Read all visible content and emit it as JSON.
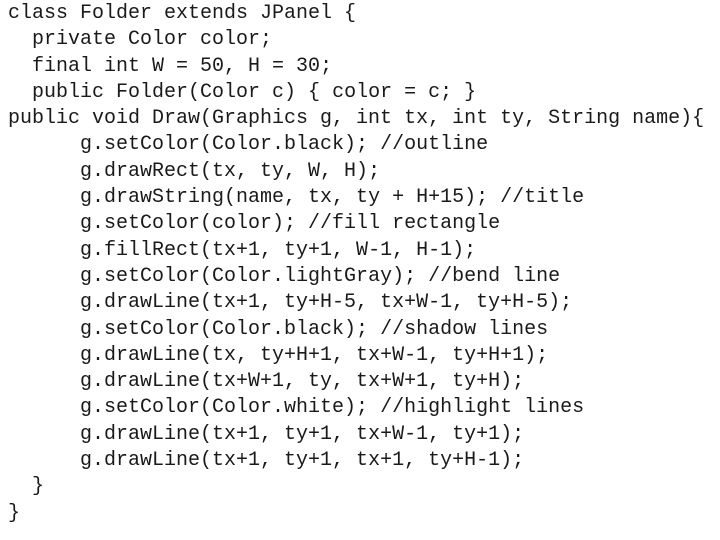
{
  "document": {
    "type": "java-source-code",
    "lines": [
      {
        "indent": 0,
        "text": "class Folder extends JPanel {"
      },
      {
        "indent": 2,
        "text": "private Color color;"
      },
      {
        "indent": 2,
        "text": "final int W = 50, H = 30;"
      },
      {
        "indent": 2,
        "text": "public Folder(Color c) { color = c; }"
      },
      {
        "indent": 0,
        "text": "public void Draw(Graphics g, int tx, int ty, String name){"
      },
      {
        "indent": 6,
        "text": "g.setColor(Color.black); //outline"
      },
      {
        "indent": 6,
        "text": "g.drawRect(tx, ty, W, H);"
      },
      {
        "indent": 6,
        "text": "g.drawString(name, tx, ty + H+15); //title"
      },
      {
        "indent": 6,
        "text": "g.setColor(color); //fill rectangle"
      },
      {
        "indent": 6,
        "text": "g.fillRect(tx+1, ty+1, W-1, H-1);"
      },
      {
        "indent": 6,
        "text": "g.setColor(Color.lightGray); //bend line"
      },
      {
        "indent": 6,
        "text": "g.drawLine(tx+1, ty+H-5, tx+W-1, ty+H-5);"
      },
      {
        "indent": 6,
        "text": "g.setColor(Color.black); //shadow lines"
      },
      {
        "indent": 6,
        "text": "g.drawLine(tx, ty+H+1, tx+W-1, ty+H+1);"
      },
      {
        "indent": 6,
        "text": "g.drawLine(tx+W+1, ty, tx+W+1, ty+H);"
      },
      {
        "indent": 6,
        "text": "g.setColor(Color.white); //highlight lines"
      },
      {
        "indent": 6,
        "text": "g.drawLine(tx+1, ty+1, tx+W-1, ty+1);"
      },
      {
        "indent": 6,
        "text": "g.drawLine(tx+1, ty+1, tx+1, ty+H-1);"
      },
      {
        "indent": 2,
        "text": "}"
      },
      {
        "indent": 0,
        "text": "}"
      }
    ]
  },
  "colors": {
    "text": "#1a1a1a",
    "background": "#ffffff"
  }
}
